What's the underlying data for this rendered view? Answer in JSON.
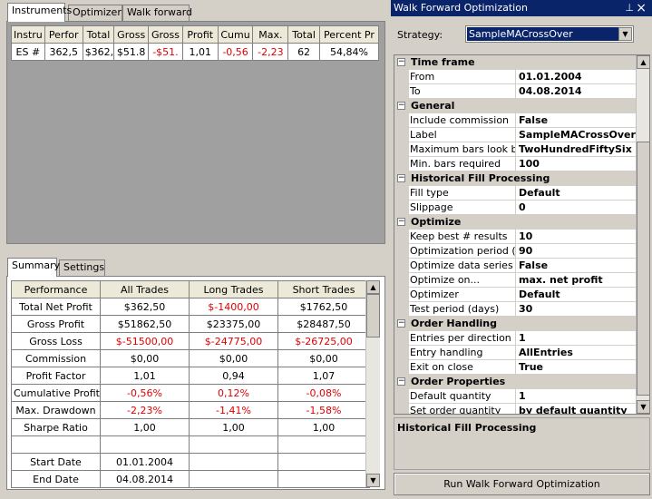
{
  "top_tabs": [
    "Instruments",
    "Optimizer",
    "Walk forward"
  ],
  "instruments_table": {
    "headers": [
      "Instru",
      "Perfor",
      "Total",
      "Gross",
      "Gross",
      "Profit",
      "Cumu",
      "Max.",
      "Total",
      "Percent Pr"
    ],
    "rows": [
      [
        "ES #",
        "362,5",
        "$362,",
        "$51.8",
        "-$51.",
        "1,01",
        "-0,56",
        "-2,23",
        "62",
        "54,84%"
      ]
    ]
  },
  "bottom_tabs": [
    "Summary",
    "Settings"
  ],
  "summary_table": {
    "headers": [
      "Performance",
      "All Trades",
      "Long Trades",
      "Short Trades"
    ],
    "rows": [
      [
        "Total Net Profit",
        "$362,50",
        "$-1400,00",
        "$1762,50"
      ],
      [
        "Gross Profit",
        "$51862,50",
        "$23375,00",
        "$28487,50"
      ],
      [
        "Gross Loss",
        "$-51500,00",
        "$-24775,00",
        "$-26725,00"
      ],
      [
        "Commission",
        "$0,00",
        "$0,00",
        "$0,00"
      ],
      [
        "Profit Factor",
        "1,01",
        "0,94",
        "1,07"
      ],
      [
        "Cumulative Profit",
        "-0,56%",
        "0,12%",
        "-0,08%"
      ],
      [
        "Max. Drawdown",
        "-2,23%",
        "-1,41%",
        "-1,58%"
      ],
      [
        "Sharpe Ratio",
        "1,00",
        "1,00",
        "1,00"
      ],
      [
        "",
        "",
        "",
        ""
      ],
      [
        "Start Date",
        "01.01.2004",
        "",
        ""
      ],
      [
        "End Date",
        "04.08.2014",
        "",
        ""
      ]
    ],
    "red_cells": [
      [
        0,
        2
      ],
      [
        2,
        1
      ],
      [
        2,
        2
      ],
      [
        2,
        3
      ],
      [
        5,
        1
      ],
      [
        5,
        2
      ],
      [
        5,
        3
      ],
      [
        6,
        1
      ],
      [
        6,
        2
      ],
      [
        6,
        3
      ]
    ]
  },
  "wfo": {
    "title": "Walk Forward Optimization",
    "pin_glyph": "⊥",
    "close_glyph": "×",
    "strategy_label": "Strategy:",
    "strategy_value": "SampleMACrossOver",
    "properties": [
      {
        "type": "cat",
        "label": "Time frame"
      },
      {
        "type": "prop",
        "name": "From",
        "value": "01.01.2004"
      },
      {
        "type": "prop",
        "name": "To",
        "value": "04.08.2014"
      },
      {
        "type": "cat",
        "label": "General"
      },
      {
        "type": "prop",
        "name": "Include commission",
        "value": "False"
      },
      {
        "type": "prop",
        "name": "Label",
        "value": "SampleMACrossOver"
      },
      {
        "type": "prop",
        "name": "Maximum bars look bac",
        "value": "TwoHundredFiftySix"
      },
      {
        "type": "prop",
        "name": "Min. bars required",
        "value": "100"
      },
      {
        "type": "cat",
        "label": "Historical Fill Processing"
      },
      {
        "type": "prop",
        "name": "Fill type",
        "value": "Default"
      },
      {
        "type": "prop",
        "name": "Slippage",
        "value": "0"
      },
      {
        "type": "cat",
        "label": "Optimize"
      },
      {
        "type": "prop",
        "name": "Keep best # results",
        "value": "10"
      },
      {
        "type": "prop",
        "name": "Optimization period (da",
        "value": "90"
      },
      {
        "type": "prop",
        "name": "Optimize data series",
        "value": "False"
      },
      {
        "type": "prop",
        "name": "Optimize on...",
        "value": "max. net profit"
      },
      {
        "type": "prop",
        "name": "Optimizer",
        "value": "Default"
      },
      {
        "type": "prop",
        "name": "Test period (days)",
        "value": "30"
      },
      {
        "type": "cat",
        "label": "Order Handling"
      },
      {
        "type": "prop",
        "name": "Entries per direction",
        "value": "1"
      },
      {
        "type": "prop",
        "name": "Entry handling",
        "value": "AllEntries"
      },
      {
        "type": "prop",
        "name": "Exit on close",
        "value": "True"
      },
      {
        "type": "cat",
        "label": "Order Properties"
      },
      {
        "type": "prop",
        "name": "Default quantity",
        "value": "1"
      },
      {
        "type": "prop",
        "name": "Set order quantity",
        "value": "by default quantity"
      }
    ],
    "description_title": "Historical Fill Processing",
    "run_button": "Run Walk Forward Optimization"
  },
  "colors": {
    "window_bg": "#d4d0c8",
    "grid_gray": "#a0a0a0",
    "title_bar": "#0a246a",
    "negative": "#e00000"
  }
}
